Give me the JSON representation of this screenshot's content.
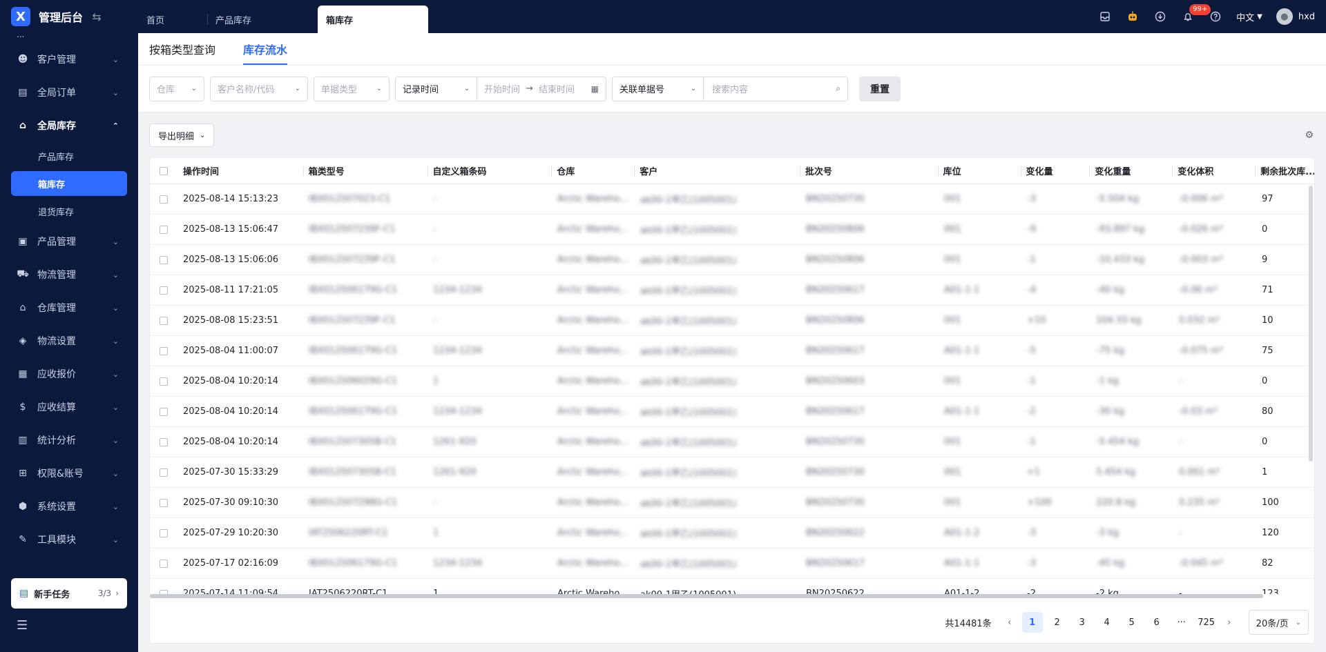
{
  "app": {
    "title": "管理后台",
    "logo_letter": "X"
  },
  "tabs": [
    {
      "label": "首页"
    },
    {
      "label": "产品库存"
    },
    {
      "label": "箱库存"
    }
  ],
  "header": {
    "notification_badge": "99+",
    "language": "中文",
    "username": "hxd"
  },
  "sidebar": {
    "partial_item": "...",
    "items": [
      {
        "label": "客户管理",
        "icon": "customer-icon"
      },
      {
        "label": "全局订单",
        "icon": "order-icon"
      },
      {
        "label": "全局库存",
        "icon": "warehouse-icon"
      },
      {
        "label": "产品管理",
        "icon": "product-icon"
      },
      {
        "label": "物流管理",
        "icon": "truck-icon"
      },
      {
        "label": "仓库管理",
        "icon": "storehouse-icon"
      },
      {
        "label": "物流设置",
        "icon": "box-icon"
      },
      {
        "label": "应收报价",
        "icon": "quote-icon"
      },
      {
        "label": "应收结算",
        "icon": "dollar-icon"
      },
      {
        "label": "统计分析",
        "icon": "chart-icon"
      },
      {
        "label": "权限&账号",
        "icon": "org-icon"
      },
      {
        "label": "系统设置",
        "icon": "hexagon-icon"
      },
      {
        "label": "工具模块",
        "icon": "tool-icon"
      }
    ],
    "sub_items": [
      {
        "label": "产品库存"
      },
      {
        "label": "箱库存"
      },
      {
        "label": "退货库存"
      }
    ],
    "task": {
      "label": "新手任务",
      "count": "3/3"
    }
  },
  "subtabs": [
    {
      "label": "按箱类型查询"
    },
    {
      "label": "库存流水"
    }
  ],
  "filters": {
    "warehouse_placeholder": "仓库",
    "customer_placeholder": "客户名称/代码",
    "doc_type_placeholder": "单据类型",
    "time_type": "记录时间",
    "start_placeholder": "开始时间",
    "end_placeholder": "结束时间",
    "ref_type": "关联单据号",
    "search_placeholder": "搜索内容",
    "reset_label": "重置"
  },
  "toolbar": {
    "export_label": "导出明细"
  },
  "table": {
    "columns": [
      "操作时间",
      "箱类型号",
      "自定义箱条码",
      "仓库",
      "客户",
      "批次号",
      "库位",
      "变化量",
      "变化重量",
      "变化体积",
      "剩余批次库..."
    ],
    "rows": [
      [
        "2025-08-14 15:13:23",
        "IBX012507023-C1",
        "-",
        "Arctic Wareho...",
        "ak00-1甲乙(1005001)",
        "BN20250730",
        "001",
        "-3",
        "-5.504 kg",
        "-0.006 m³",
        "97"
      ],
      [
        "2025-08-13 15:06:47",
        "IBX012507239F-C1",
        "-",
        "Arctic Wareho...",
        "ak00-1甲乙(1005001)",
        "BN20250806",
        "001",
        "-9",
        "-93.897 kg",
        "-0.026 m³",
        "0"
      ],
      [
        "2025-08-13 15:06:06",
        "IBX012507239F-C1",
        "-",
        "Arctic Wareho...",
        "ak00-1甲乙(1005001)",
        "BN20250806",
        "001",
        "-1",
        "-10.433 kg",
        "-0.003 m³",
        "9"
      ],
      [
        "2025-08-11 17:21:05",
        "IBX012506179G-C1",
        "1234-1234",
        "Arctic Wareho...",
        "ak00-1甲乙(1005001)",
        "BN20250617",
        "A01-1-1",
        "-4",
        "-40 kg",
        "-0.06 m³",
        "71"
      ],
      [
        "2025-08-08 15:23:51",
        "IBX012507239F-C1",
        "-",
        "Arctic Wareho...",
        "ak00-1甲乙(1005001)",
        "BN20250806",
        "001",
        "+10",
        "104.33 kg",
        "0.032 m³",
        "10"
      ],
      [
        "2025-08-04 11:00:07",
        "IBX012506179G-C1",
        "1234-1234",
        "Arctic Wareho...",
        "ak00-1甲乙(1005001)",
        "BN20250617",
        "A01-1-1",
        "-5",
        "-75 kg",
        "-0.075 m³",
        "75"
      ],
      [
        "2025-08-04 10:20:14",
        "IBX012506029G-C1",
        "1",
        "Arctic Wareho...",
        "ak00-1甲乙(1005001)",
        "BN20250603",
        "001",
        "-1",
        "-1 kg",
        "-",
        "0"
      ],
      [
        "2025-08-04 10:20:14",
        "IBX012506179G-C1",
        "1234-1234",
        "Arctic Wareho...",
        "ak00-1甲乙(1005001)",
        "BN20250617",
        "A01-1-1",
        "-2",
        "-30 kg",
        "-0.03 m³",
        "80"
      ],
      [
        "2025-08-04 10:20:14",
        "IBX012507305B-C1",
        "1261-920",
        "Arctic Wareho...",
        "ak00-1甲乙(1005001)",
        "BN20250730",
        "001",
        "-1",
        "-5.454 kg",
        "-",
        "0"
      ],
      [
        "2025-07-30 15:33:29",
        "IBX012507305B-C1",
        "1261-920",
        "Arctic Wareho...",
        "ak00-1甲乙(1005001)",
        "BN20250730",
        "001",
        "+1",
        "5.454 kg",
        "0.001 m³",
        "1"
      ],
      [
        "2025-07-30 09:10:30",
        "IBX012507298G-C1",
        "-",
        "Arctic Wareho...",
        "ak00-1甲乙(1005001)",
        "BN20250730",
        "001",
        "+100",
        "220.8 kg",
        "0.235 m³",
        "100"
      ],
      [
        "2025-07-29 10:20:30",
        "IAT2506220RT-C1",
        "1",
        "Arctic Wareho...",
        "ak00-1甲乙(1005001)",
        "BN20250622",
        "A01-1-2",
        "-3",
        "-3 kg",
        "-",
        "120"
      ],
      [
        "2025-07-17 02:16:09",
        "IBX012506179G-C1",
        "1234-1234",
        "Arctic Wareho...",
        "ak00-1甲乙(1005001)",
        "BN20250617",
        "A01-1-1",
        "-3",
        "-45 kg",
        "-0.045 m³",
        "82"
      ],
      [
        "2025-07-14 11:09:54",
        "IAT2506220RT-C1",
        "1",
        "Arctic Wareho...",
        "ak00-1甲乙(1005001)",
        "BN20250622",
        "A01-1-2",
        "-2",
        "-2 kg",
        "-",
        "123"
      ]
    ]
  },
  "pagination": {
    "total": "共14481条",
    "pages": [
      "1",
      "2",
      "3",
      "4",
      "5",
      "6"
    ],
    "ellipsis": "···",
    "last": "725",
    "page_size": "20条/页"
  }
}
